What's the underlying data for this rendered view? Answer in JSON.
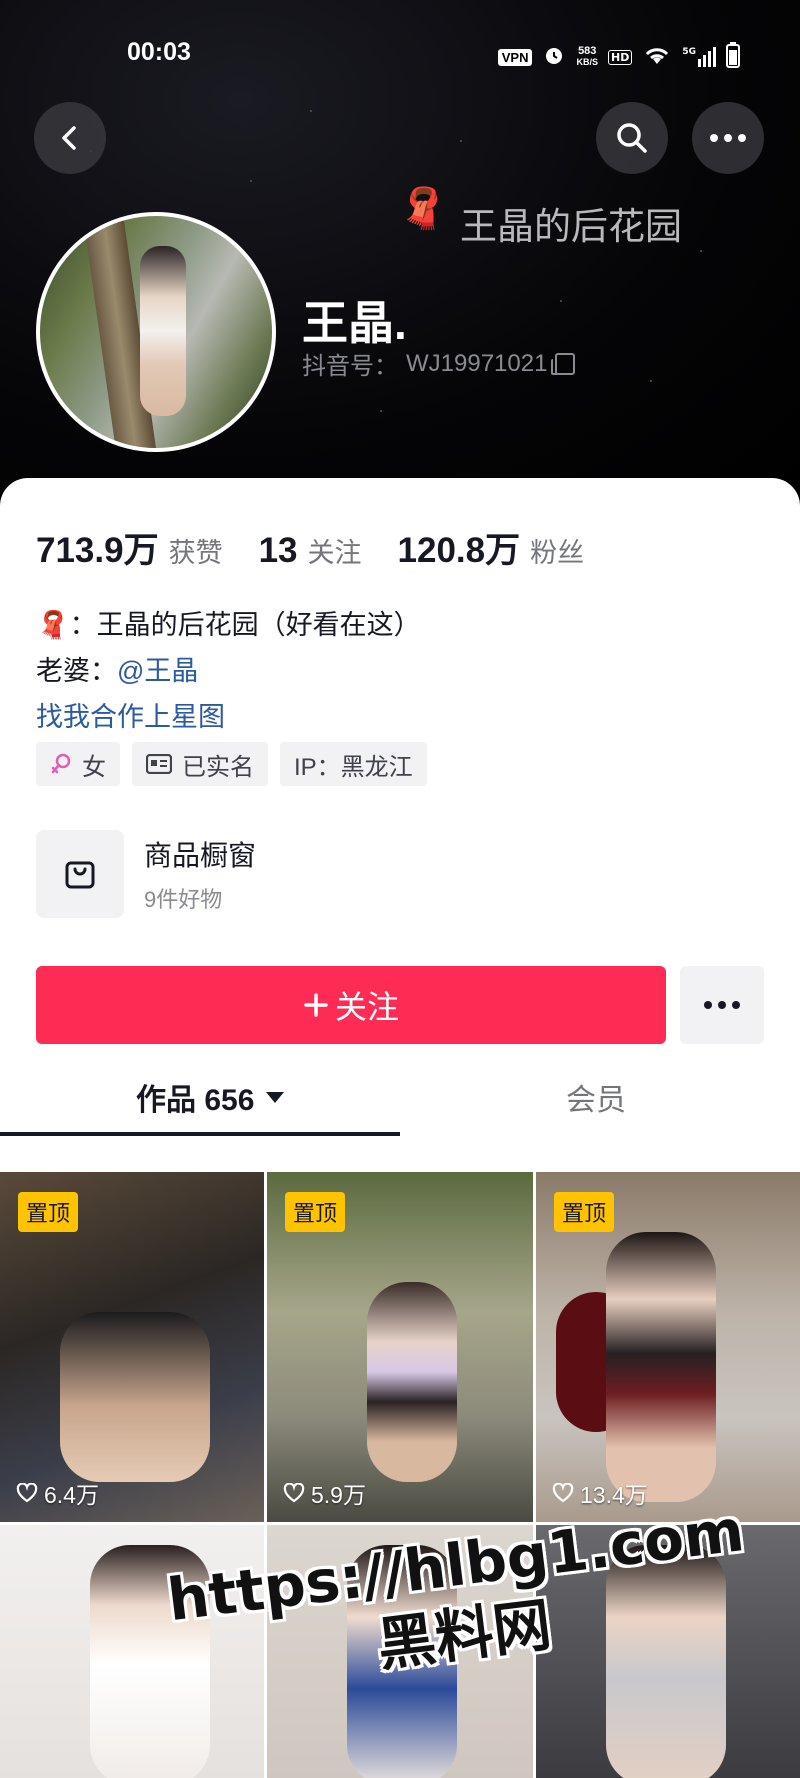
{
  "status_bar": {
    "time": "00:03",
    "vpn": "VPN",
    "speed_value": "583",
    "speed_unit": "KB/S",
    "hd": "HD",
    "network": "5G"
  },
  "header": {
    "back_icon": "chevron-left-icon",
    "search_icon": "search-icon",
    "more_icon": "more-horizontal-icon",
    "garden_emoji": "🧣",
    "garden_title": "王晶的后花园",
    "nickname": "王晶.",
    "douyin_id_label": "抖音号：",
    "douyin_id": "WJ19971021"
  },
  "stats": [
    {
      "value": "713.9万",
      "label": "获赞"
    },
    {
      "value": "13",
      "label": "关注"
    },
    {
      "value": "120.8万",
      "label": "粉丝"
    }
  ],
  "bio": {
    "line1_emoji": "🧣",
    "line1_text": "：王晶的后花园（好看在这）",
    "line2_prefix": "老婆：",
    "line2_link": "@王晶",
    "line3_link": "找我合作上星图"
  },
  "tags": [
    {
      "icon": "female-icon",
      "label": "女"
    },
    {
      "icon": "id-card-icon",
      "label": "已实名"
    },
    {
      "icon": "",
      "label": "IP：黑龙江"
    }
  ],
  "shop": {
    "icon": "shopping-bag-icon",
    "title": "商品橱窗",
    "subtitle": "9件好物"
  },
  "actions": {
    "follow_label": "关注",
    "follow_color": "#fe2c55"
  },
  "tabs": {
    "works_label": "作品 656",
    "member_label": "会员"
  },
  "videos": [
    {
      "pinned": "置顶",
      "likes": "6.4万"
    },
    {
      "pinned": "置顶",
      "likes": "5.9万"
    },
    {
      "pinned": "置顶",
      "likes": "13.4万"
    },
    {
      "pinned": "",
      "likes": ""
    },
    {
      "pinned": "",
      "likes": ""
    },
    {
      "pinned": "",
      "likes": ""
    }
  ],
  "watermark": {
    "line1": "https://hlbg1.com",
    "line2": "黑料网"
  }
}
